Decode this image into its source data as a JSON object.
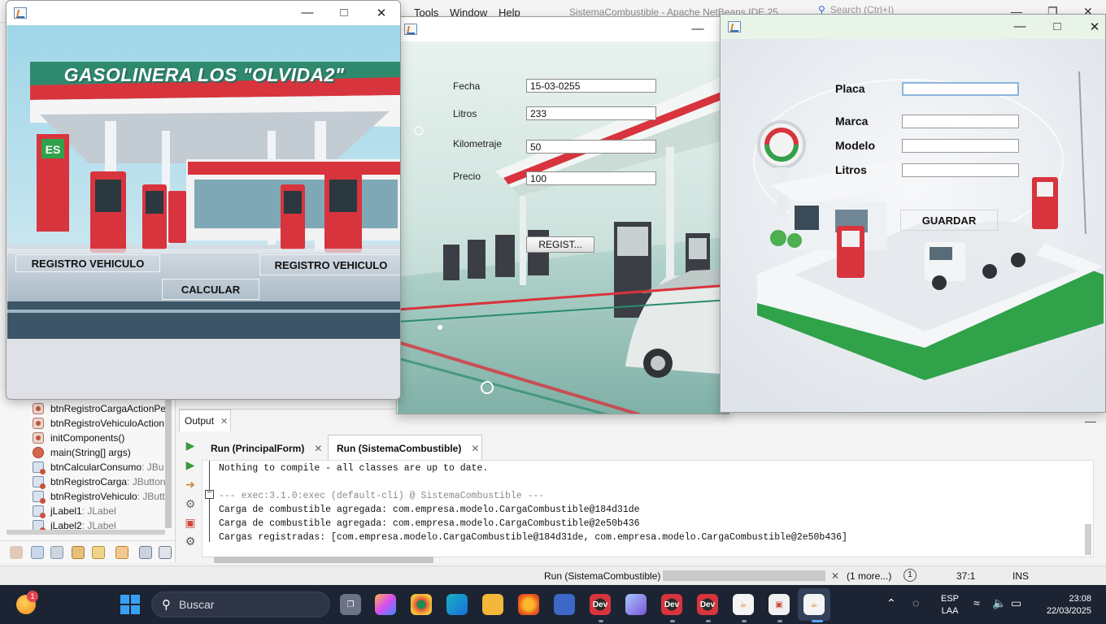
{
  "ide": {
    "menu": [
      "Tools",
      "Window",
      "Help"
    ],
    "title": "SistemaCombustible - Apache NetBeans IDE 25",
    "search_placeholder": "Search (Ctrl+I)",
    "navigator": [
      {
        "name": "btnRegistroCargaActionPe",
        "type": "",
        "kind": "method"
      },
      {
        "name": "btnRegistroVehiculoAction",
        "type": "",
        "kind": "method"
      },
      {
        "name": "initComponents()",
        "type": "",
        "kind": "method"
      },
      {
        "name": "main(String[] args)",
        "type": "",
        "kind": "static"
      },
      {
        "name": "btnCalcularConsumo",
        "type": " : JBu",
        "kind": "field"
      },
      {
        "name": "btnRegistroCarga",
        "type": " : JButton",
        "kind": "field"
      },
      {
        "name": "btnRegistroVehiculo",
        "type": " : JButt",
        "kind": "field"
      },
      {
        "name": "jLabel1",
        "type": " : JLabel",
        "kind": "field"
      },
      {
        "name": "jLabel2",
        "type": " : JLabel",
        "kind": "field"
      }
    ],
    "output": {
      "tab_label": "Output",
      "run_tabs": [
        "Run (PrincipalForm)",
        "Run (SistemaCombustible)"
      ],
      "lines": [
        {
          "text": "Nothing to compile - all classes are up to date.",
          "style": "normal"
        },
        {
          "text": "",
          "style": "normal"
        },
        {
          "text": "--- exec:3.1.0:exec (default-cli) @ SistemaCombustible ---",
          "style": "gray"
        },
        {
          "text": "Carga de combustible agregada: com.empresa.modelo.CargaCombustible@184d31de",
          "style": "normal"
        },
        {
          "text": "Carga de combustible agregada: com.empresa.modelo.CargaCombustible@2e50b436",
          "style": "normal"
        },
        {
          "text": "Cargas registradas: [com.empresa.modelo.CargaCombustible@184d31de, com.empresa.modelo.CargaCombustible@2e50b436]",
          "style": "normal"
        }
      ]
    },
    "status": {
      "task": "Run (SistemaCombustible)",
      "more": "(1 more...)",
      "notifications": "1",
      "position": "37:1",
      "mode": "INS"
    }
  },
  "principal": {
    "title": "GASOLINERA LOS \"OLVIDA2\"",
    "station_sign": "ES",
    "btn_registro_vehiculo_left": "REGISTRO VEHICULO",
    "btn_registro_vehiculo_right": "REGISTRO VEHICULO",
    "btn_calcular": "CALCULAR"
  },
  "carga": {
    "fields": [
      {
        "label": "Fecha",
        "value": "15-03-0255"
      },
      {
        "label": "Litros",
        "value": "233"
      },
      {
        "label": "Kilometraje",
        "value": "50"
      },
      {
        "label": "Precio",
        "value": "100"
      }
    ],
    "button": "REGIST..."
  },
  "vehiculo": {
    "fields": [
      {
        "label": "Placa",
        "value": ""
      },
      {
        "label": "Marca",
        "value": ""
      },
      {
        "label": "Modelo",
        "value": ""
      },
      {
        "label": "Litros",
        "value": ""
      }
    ],
    "button": "GUARDAR"
  },
  "taskbar": {
    "badge": "1",
    "search_label": "Buscar",
    "app_labels": {
      "dev": "Dev"
    },
    "lang_line1": "ESP",
    "lang_line2": "LAA",
    "time": "23:08",
    "date": "22/03/2025"
  },
  "colors": {
    "taskbar_bg": "#1c2433",
    "title_shadow": "#2a6c5e",
    "accent_red": "#d8343d",
    "accent_green": "#2fa24a"
  }
}
